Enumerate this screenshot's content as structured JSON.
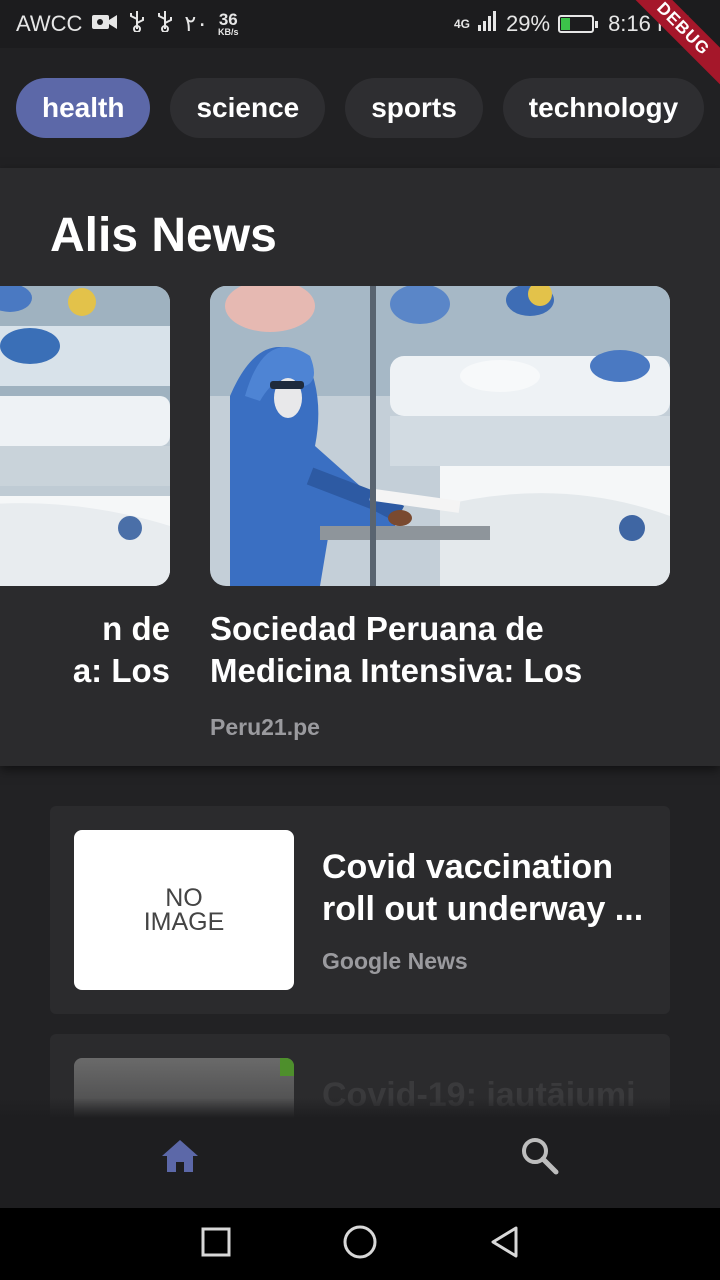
{
  "status_bar": {
    "carrier": "AWCC",
    "signal_extra": "٢٠",
    "net_speed_value": "36",
    "net_speed_unit": "KB/s",
    "network_type": "4G",
    "battery_percent": "29%",
    "battery_level": 0.29,
    "time": "8:16 PM",
    "debug_label": "DEBUG"
  },
  "categories": [
    {
      "label": "health",
      "active": true
    },
    {
      "label": "science",
      "active": false
    },
    {
      "label": "sports",
      "active": false
    },
    {
      "label": "technology",
      "active": false
    }
  ],
  "app": {
    "title": "Alis News"
  },
  "carousel": {
    "prev": {
      "title_line1": "n de",
      "title_line2": "a: Los"
    },
    "current": {
      "title": "Sociedad Peruana de Medicina Intensiva: Los",
      "source": "Peru21.pe"
    }
  },
  "list": [
    {
      "title_line1": "Covid vaccination",
      "title_line2": "roll out underway ...",
      "source": "Google News",
      "thumb_text_line1": "NO",
      "thumb_text_line2": "IMAGE"
    },
    {
      "title_line1": "Covid-19: iautāiumi"
    }
  ],
  "bottom_nav": {
    "home_icon": "home-icon",
    "search_icon": "search-icon",
    "active_color": "#5c68a8"
  },
  "colors": {
    "accent": "#5c68a8",
    "background": "#222224",
    "card": "#2b2b2d",
    "debug_ribbon": "#a5172a"
  }
}
